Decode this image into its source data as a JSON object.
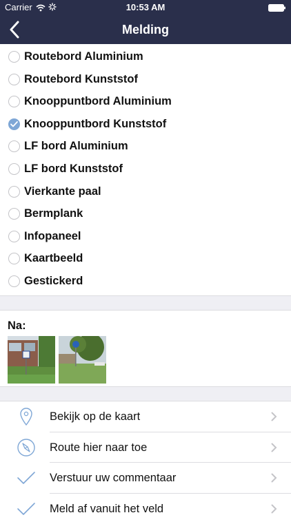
{
  "status_bar": {
    "carrier": "Carrier",
    "time": "10:53 AM"
  },
  "navbar": {
    "title": "Melding",
    "back_icon": "chevron-left-icon"
  },
  "options": [
    {
      "label": "Routebord Aluminium",
      "checked": false
    },
    {
      "label": "Routebord Kunststof",
      "checked": false
    },
    {
      "label": "Knooppuntbord Aluminium",
      "checked": false
    },
    {
      "label": "Knooppuntbord Kunststof",
      "checked": true
    },
    {
      "label": "LF bord Aluminium",
      "checked": false
    },
    {
      "label": "LF bord Kunststof",
      "checked": false
    },
    {
      "label": "Vierkante paal",
      "checked": false
    },
    {
      "label": "Bermplank",
      "checked": false
    },
    {
      "label": "Infopaneel",
      "checked": false
    },
    {
      "label": "Kaartbeeld",
      "checked": false
    },
    {
      "label": "Gestickerd",
      "checked": false
    }
  ],
  "photos": {
    "label": "Na:",
    "count": 2
  },
  "actions": [
    {
      "label": "Bekijk op de kaart",
      "icon": "map-pin-icon"
    },
    {
      "label": "Route hier naar toe",
      "icon": "compass-icon"
    },
    {
      "label": "Verstuur uw commentaar",
      "icon": "checkmark-icon"
    },
    {
      "label": "Meld af vanuit het veld",
      "icon": "checkmark-icon"
    }
  ],
  "colors": {
    "navbar": "#2a2f4b",
    "accent": "#7fa7d6",
    "background_gap": "#efeff4"
  }
}
